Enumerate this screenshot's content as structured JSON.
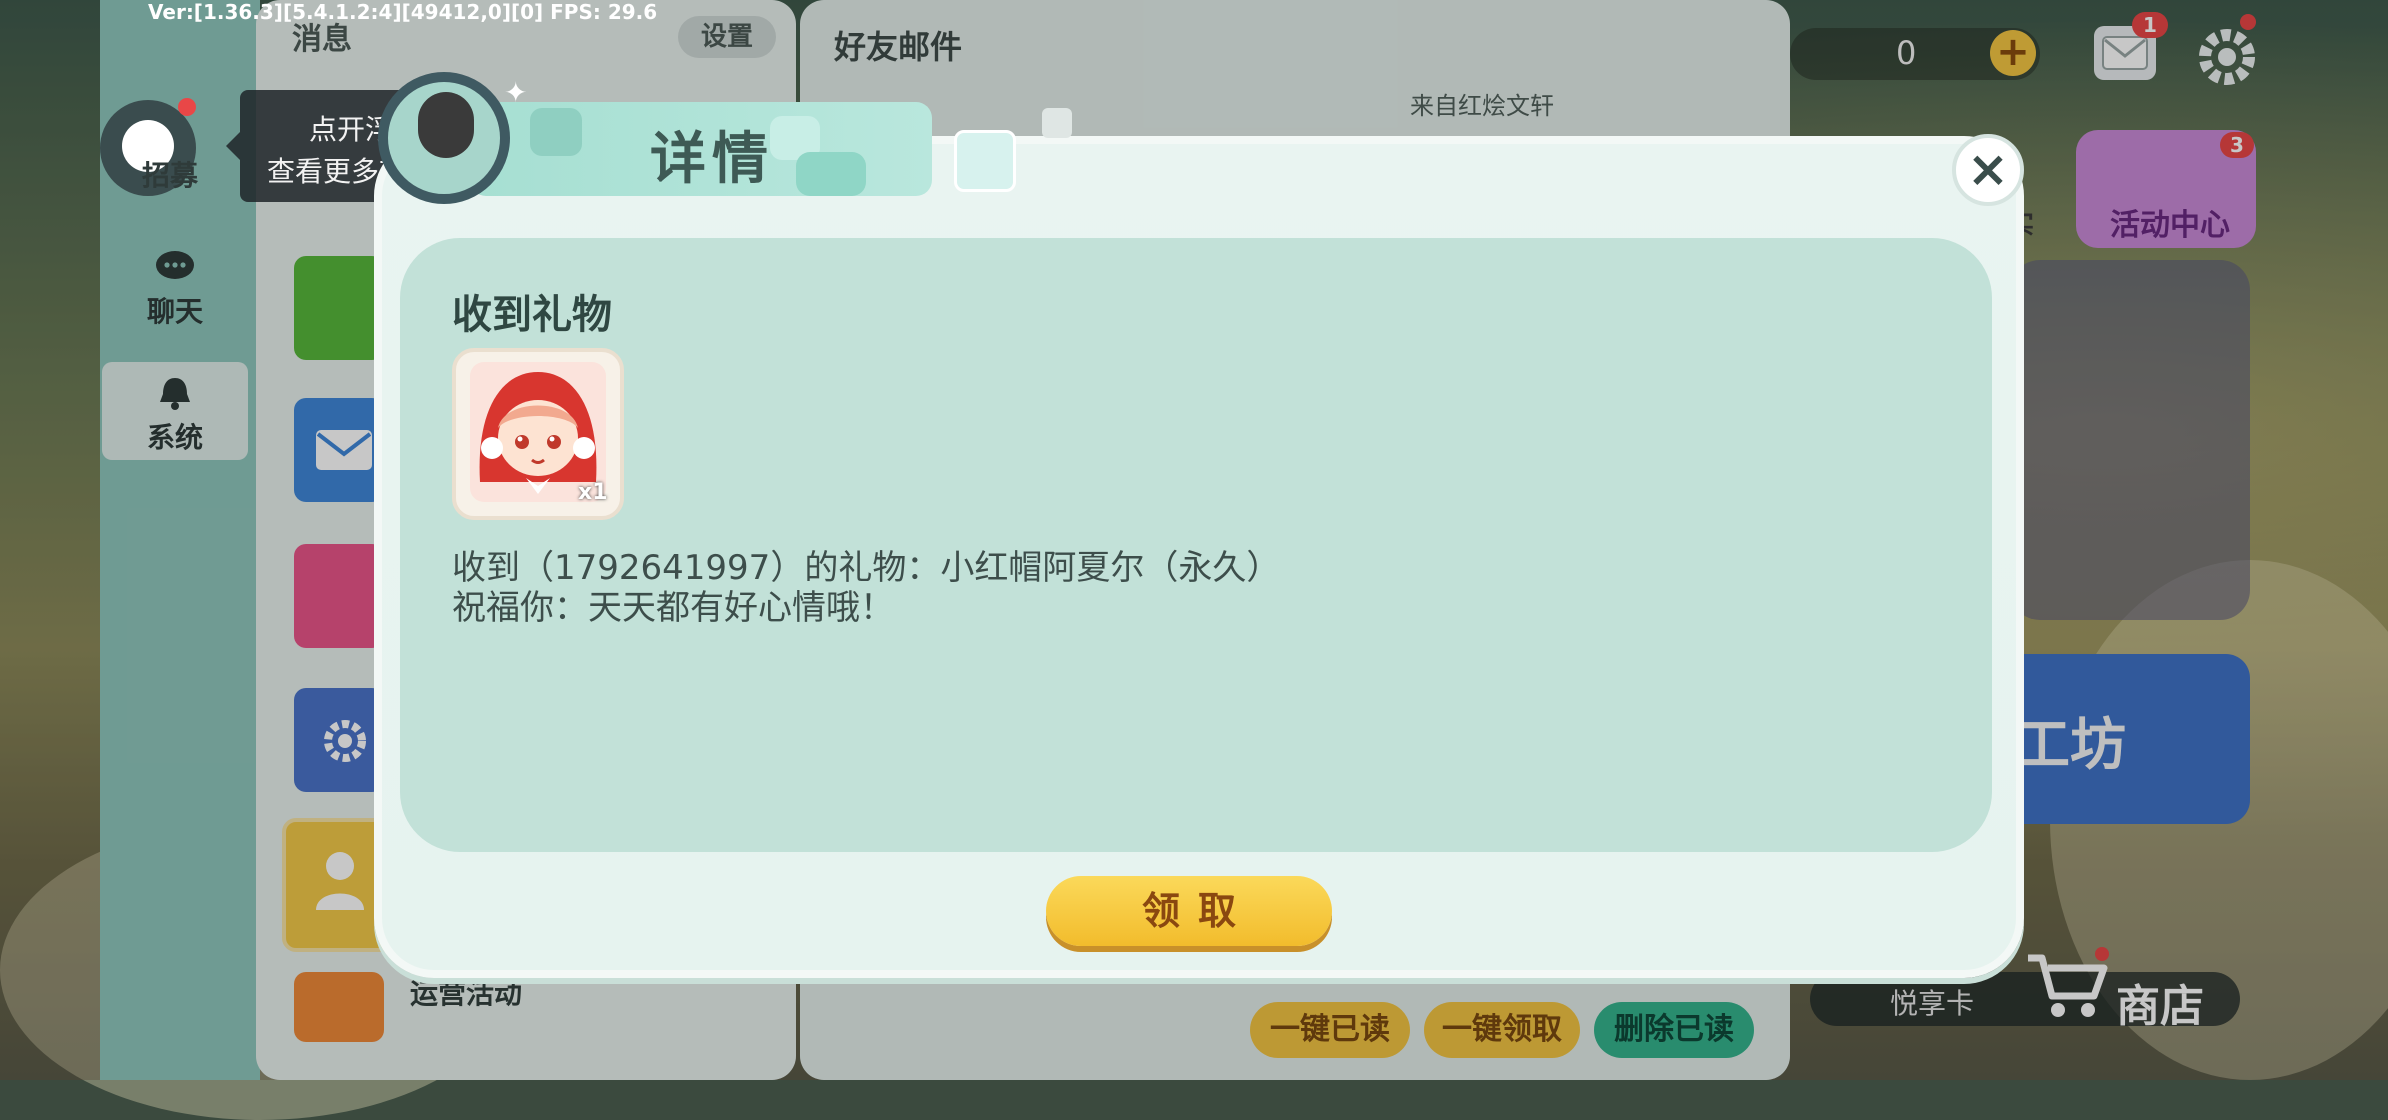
{
  "debug": {
    "version_text": "Ver:[1.36.3][5.4.1.2:4][49412,0][0] FPS: 29.6"
  },
  "rail": {
    "items": [
      {
        "label": "招募",
        "icon": "recruit-icon"
      },
      {
        "label": "聊天",
        "icon": "chat-icon"
      },
      {
        "label": "系统",
        "icon": "bell-icon",
        "selected": true
      }
    ]
  },
  "float_ball": {
    "tooltip_line1": "点开浮球",
    "tooltip_line2": "查看更多功能哦"
  },
  "message_panel": {
    "title": "消息",
    "settings_label": "设置",
    "ops_label": "运营活动"
  },
  "mail_panel": {
    "title": "好友邮件",
    "from_text": "来自红烩文轩",
    "btn_read_all": "一键已读",
    "btn_claim_all": "一键领取",
    "btn_delete_read": "删除已读"
  },
  "hud": {
    "coin_value": "0",
    "plus_symbol": "+",
    "mail_badge": "1",
    "activity_label": "活动中心",
    "activity_badge": "3",
    "real_label": "实",
    "workshop_label": "工坊",
    "yuexiang_label": "悦享卡",
    "shop_label": "商店"
  },
  "dialog": {
    "title": "详情",
    "close_symbol": "×",
    "gift_heading": "收到礼物",
    "gift_quantity": "x1",
    "line1": "收到（1792641997）的礼物：小红帽阿夏尔（永久）",
    "line2": "祝福你：天天都有好心情哦！",
    "claim_label": "领取"
  },
  "colors": {
    "dialog_bg": "#e9f4f1",
    "dialog_inner": "#c2e1d8",
    "title_tab": "#a6dfd2",
    "claim_button": "#f2bc2c",
    "delete_button": "#35b48e",
    "badge_red": "#e94747"
  }
}
